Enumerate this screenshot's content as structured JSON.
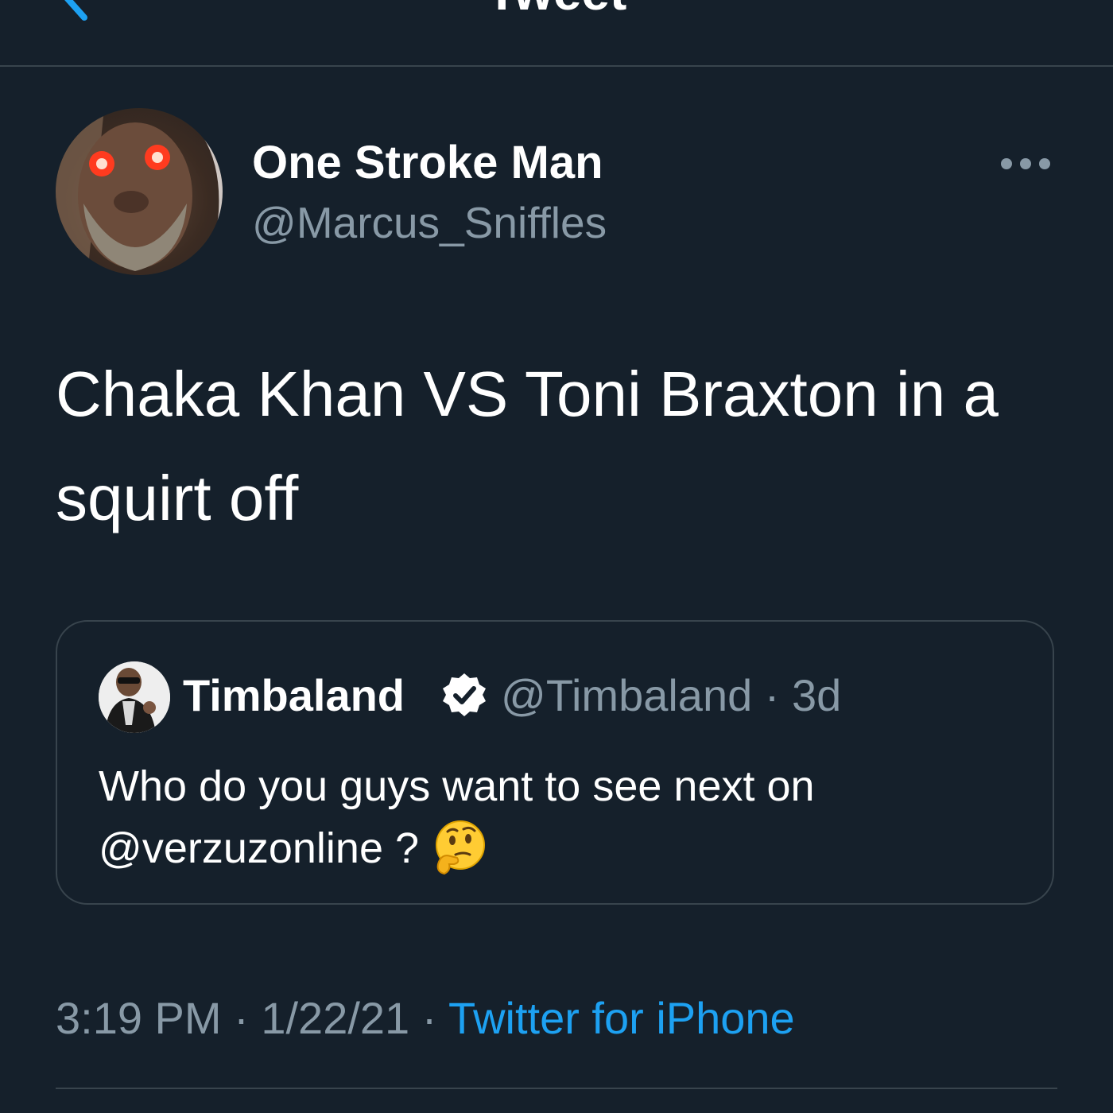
{
  "header": {
    "title": "Tweet",
    "back_icon": "chevron-left-icon"
  },
  "author": {
    "display_name": "One Stroke Man",
    "handle": "@Marcus_Sniffles"
  },
  "tweet": {
    "text": "Chaka Khan VS Toni Braxton in a squirt off"
  },
  "quoted_tweet": {
    "display_name": "Timbaland",
    "verified": true,
    "handle": "@Timbaland",
    "separator": "·",
    "age": "3d",
    "text": "Who do you guys want to see next on @verzuzonline ?",
    "emoji_icon": "thinking-face-icon"
  },
  "meta": {
    "time": "3:19 PM",
    "date": "1/22/21",
    "separator": "·",
    "source": "Twitter for iPhone"
  },
  "colors": {
    "background": "#15202b",
    "accent": "#1da1f2",
    "secondary_text": "#8899a6",
    "border": "#38444d"
  }
}
